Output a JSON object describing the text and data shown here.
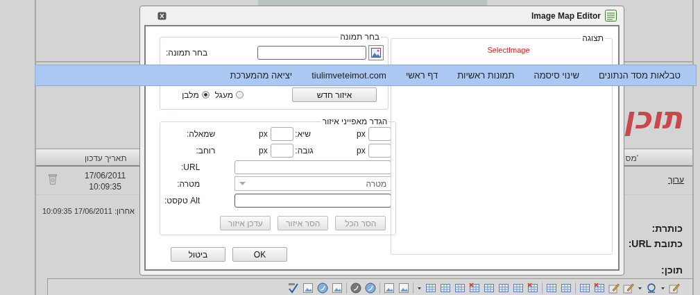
{
  "page": {
    "nav": [
      "טבלאות מסד הנתונים",
      "שינוי סיסמה",
      "תמונות ראשיות",
      "דף ראשי",
      "tiulimveteimot.com",
      "יציאה מהמערכת"
    ],
    "heading": "תוכן",
    "table": {
      "columns": [
        "מס'",
        "תאריך עדכון"
      ],
      "rows": [
        {
          "edit_link": "ערוך",
          "date": "17/06/2011",
          "time": "10:09:35"
        }
      ]
    },
    "last_updated": "אחרון: 17/06/2011 10:09:35",
    "form_labels": [
      "כותרת:",
      "כתובת URL:",
      "תוכן:"
    ]
  },
  "dialog": {
    "title": "Image Map Editor",
    "preview": {
      "legend": "תצוגה",
      "message": "SelectImage"
    },
    "select_image": {
      "legend": "בחר תמונה",
      "label": "בחר תמונה:",
      "new_area_button": "איזור חדש",
      "shapes": [
        {
          "label": "מעגל",
          "selected": false
        },
        {
          "label": "מלבן",
          "selected": true
        }
      ]
    },
    "area": {
      "legend": "הגדר מאפייני איזור",
      "coord_rows": [
        [
          {
            "unit": "px",
            "label": "שיא:"
          },
          {
            "unit": "px",
            "label": "שמאלה:"
          }
        ],
        [
          {
            "unit": "px",
            "label": "גובה:"
          },
          {
            "unit": "px",
            "label": "רוחב:"
          }
        ]
      ],
      "url_label": "URL:",
      "target": {
        "placeholder": "מטרה",
        "label": "מטרה:"
      },
      "alt_label": "Alt טקסט:",
      "buttons": [
        {
          "label": "הסר הכל",
          "disabled": true
        },
        {
          "label": "הסר איזור",
          "disabled": true
        },
        {
          "label": "עדכן איזור",
          "disabled": true
        }
      ]
    },
    "footer_buttons": [
      "OK",
      "ביטול"
    ]
  }
}
